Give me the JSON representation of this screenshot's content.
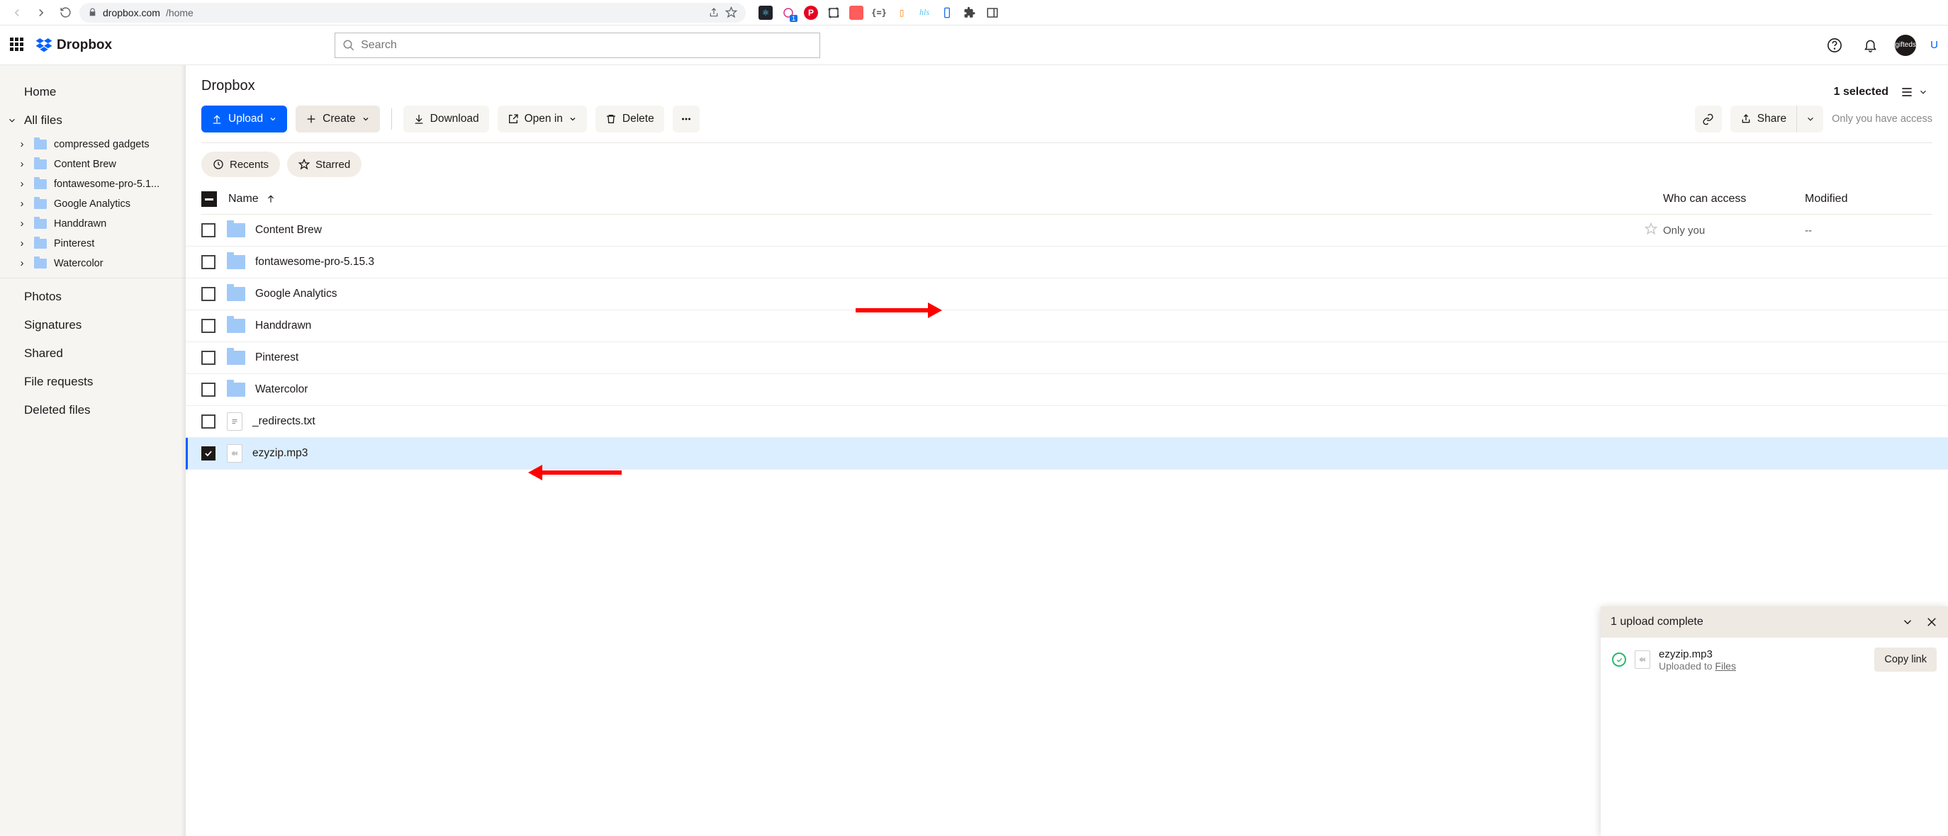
{
  "browser": {
    "url_host": "dropbox.com",
    "url_path": "/home"
  },
  "brand": "Dropbox",
  "search": {
    "placeholder": "Search"
  },
  "upgrade_label": "U",
  "crumb_title": "Dropbox",
  "selected_text": "1 selected",
  "sidebar": {
    "home": "Home",
    "all_files": "All files",
    "folders": [
      "compressed gadgets",
      "Content Brew",
      "fontawesome-pro-5.1...",
      "Google Analytics",
      "Handdrawn",
      "Pinterest",
      "Watercolor"
    ],
    "photos": "Photos",
    "signatures": "Signatures",
    "shared": "Shared",
    "file_requests": "File requests",
    "deleted": "Deleted files"
  },
  "toolbar": {
    "upload": "Upload",
    "create": "Create",
    "download": "Download",
    "open_in": "Open in",
    "delete": "Delete",
    "share": "Share",
    "only_you": "Only you have access"
  },
  "chips": {
    "recents": "Recents",
    "starred": "Starred"
  },
  "columns": {
    "name": "Name",
    "who": "Who can access",
    "modified": "Modified"
  },
  "rows": [
    {
      "name": "Content Brew",
      "type": "folder",
      "who": "Only you",
      "mod": "--",
      "checked": false,
      "show_star": true
    },
    {
      "name": "fontawesome-pro-5.15.3",
      "type": "folder",
      "who": "",
      "mod": "",
      "checked": false
    },
    {
      "name": "Google Analytics",
      "type": "folder",
      "who": "",
      "mod": "",
      "checked": false
    },
    {
      "name": "Handdrawn",
      "type": "folder",
      "who": "",
      "mod": "",
      "checked": false
    },
    {
      "name": "Pinterest",
      "type": "folder",
      "who": "",
      "mod": "",
      "checked": false
    },
    {
      "name": "Watercolor",
      "type": "folder",
      "who": "",
      "mod": "",
      "checked": false
    },
    {
      "name": "_redirects.txt",
      "type": "txt",
      "who": "",
      "mod": "",
      "checked": false
    },
    {
      "name": "ezyzip.mp3",
      "type": "audio",
      "who": "",
      "mod": "",
      "checked": true
    }
  ],
  "toast": {
    "title": "1 upload complete",
    "filename": "ezyzip.mp3",
    "uploaded_to": "Uploaded to ",
    "dest": "Files",
    "copy_link": "Copy link"
  }
}
